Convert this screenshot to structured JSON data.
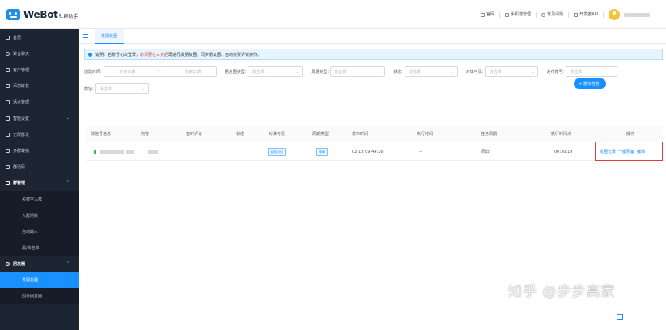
{
  "header": {
    "brand": "WeBot",
    "brand_sub": "社群助手",
    "links": [
      {
        "label": "官网",
        "icon": "monitor-icon"
      },
      {
        "label": "手机端管理",
        "icon": "phone-icon"
      },
      {
        "label": "常见问题",
        "icon": "question-icon"
      },
      {
        "label": "开发者API",
        "icon": "api-icon"
      }
    ]
  },
  "sidebar": {
    "items": [
      {
        "label": "首页",
        "icon": "home-icon"
      },
      {
        "label": "聚合聊天",
        "icon": "chat-icon"
      },
      {
        "label": "客户管理",
        "icon": "user-icon"
      },
      {
        "label": "添加好友",
        "icon": "add-user-icon"
      },
      {
        "label": "话术管理",
        "icon": "script-icon"
      },
      {
        "label": "智能设置",
        "icon": "settings-icon"
      },
      {
        "label": "无限群发",
        "icon": "send-icon"
      },
      {
        "label": "多群转播",
        "icon": "broadcast-icon"
      },
      {
        "label": "群活码",
        "icon": "qrcode-icon"
      },
      {
        "label": "群管理",
        "icon": "group-icon"
      },
      {
        "label": "关键字入群",
        "icon": ""
      },
      {
        "label": "入群问候",
        "icon": ""
      },
      {
        "label": "自动踢人",
        "icon": ""
      },
      {
        "label": "黑/白名单",
        "icon": ""
      },
      {
        "label": "朋友圈",
        "icon": "moments-icon"
      },
      {
        "label": "发朋友圈",
        "icon": ""
      },
      {
        "label": "同步朋友圈",
        "icon": ""
      }
    ]
  },
  "tabs": [
    {
      "label": "发朋友圈"
    }
  ],
  "notice": {
    "prefix": "说明：若账号初次登录，",
    "highlight": "必须要在三天后",
    "suffix": "再进行发朋友圈、同步朋友圈、自动点赞评论操作。"
  },
  "filters": {
    "created_label": "创建时间:",
    "start_placeholder": "开始日期",
    "range_sep": "-",
    "end_placeholder": "结束日期",
    "type_label": "朋友圈类型:",
    "type_placeholder": "请选择",
    "cycle_label": "周期类型:",
    "cycle_placeholder": "请选择",
    "status_label": "状态:",
    "status_placeholder": "请选择",
    "visible_label": "对谁可见:",
    "visible_placeholder": "请选择",
    "account_label": "发布账号:",
    "account_placeholder": "请选择",
    "wechat_label": "微信:",
    "wechat_placeholder": "请选择"
  },
  "add_button": {
    "label": "+ 发布任务"
  },
  "table": {
    "columns": [
      "微信号信息",
      "内容",
      "首时评论",
      "状态",
      "对谁可见",
      "周期类型",
      "发布时间",
      "执行时间",
      "任务周期",
      "执行时间点",
      "操作"
    ],
    "rows": [
      {
        "visible": "全部可见",
        "cycle": "每周",
        "publish_time": "02-18 09:44:26",
        "exec_time": "--",
        "task_cycle": "周日",
        "exec_point": "00:30:19",
        "actions": [
          "发圈记录",
          "一键预备",
          "编辑"
        ]
      }
    ]
  },
  "watermark": "知乎 @步步高家"
}
